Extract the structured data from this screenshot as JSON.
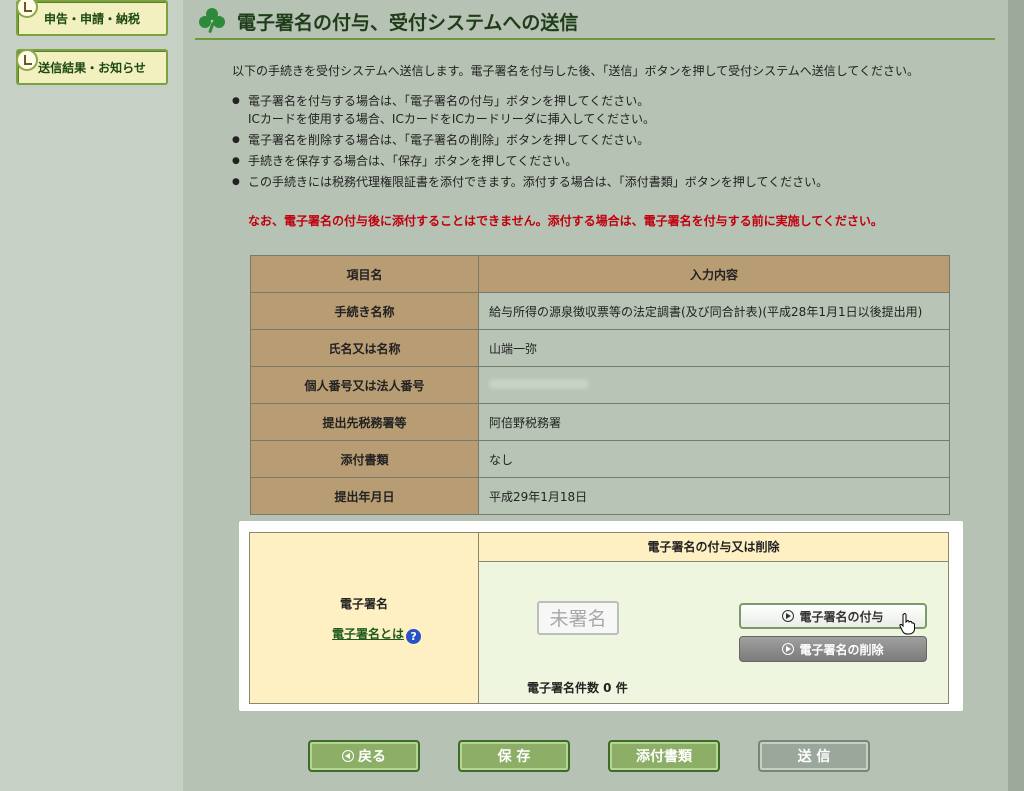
{
  "sidebar": {
    "items": [
      {
        "label": "申告・申請・納税"
      },
      {
        "label": "送信結果・お知らせ"
      }
    ]
  },
  "page": {
    "title": "電子署名の付与、受付システムへの送信",
    "intro": "以下の手続きを受付システムへ送信します。電子署名を付与した後、「送信」ボタンを押して受付システムへ送信してください。",
    "bullets": [
      "電子署名を付与する場合は、「電子署名の付与」ボタンを押してください。",
      "ICカードを使用する場合、ICカードをICカードリーダに挿入してください。",
      "電子署名を削除する場合は、「電子署名の削除」ボタンを押してください。",
      "手続きを保存する場合は、「保存」ボタンを押してください。",
      "この手続きには税務代理権限証書を添付できます。添付する場合は、「添付書類」ボタンを押してください。"
    ],
    "warning": "なお、電子署名の付与後に添付することはできません。添付する場合は、電子署名を付与する前に実施してください。"
  },
  "table": {
    "headers": [
      "項目名",
      "入力内容"
    ],
    "rows": [
      {
        "label": "手続き名称",
        "value": "給与所得の源泉徴収票等の法定調書(及び同合計表)(平成28年1月1日以後提出用)"
      },
      {
        "label": "氏名又は名称",
        "value": "山端一弥"
      },
      {
        "label": "個人番号又は法人番号",
        "value": ""
      },
      {
        "label": "提出先税務署等",
        "value": "阿倍野税務署"
      },
      {
        "label": "添付書類",
        "value": "なし"
      },
      {
        "label": "提出年月日",
        "value": "平成29年1月18日"
      }
    ]
  },
  "signature": {
    "label": "電子署名",
    "link": "電子署名とは",
    "help": "?",
    "section_title": "電子署名の付与又は削除",
    "status": "未署名",
    "sign_button": "電子署名の付与",
    "delete_button": "電子署名の削除",
    "count_text": "電子署名件数 0 件"
  },
  "buttons": {
    "back": "戻る",
    "save": "保 存",
    "attach": "添付書類",
    "send": "送 信"
  },
  "icons": {
    "sidebar_1": "document-icon",
    "sidebar_2": "notice-icon",
    "header": "clover-icon",
    "help": "help-icon",
    "cursor": "hand-cursor-icon"
  }
}
